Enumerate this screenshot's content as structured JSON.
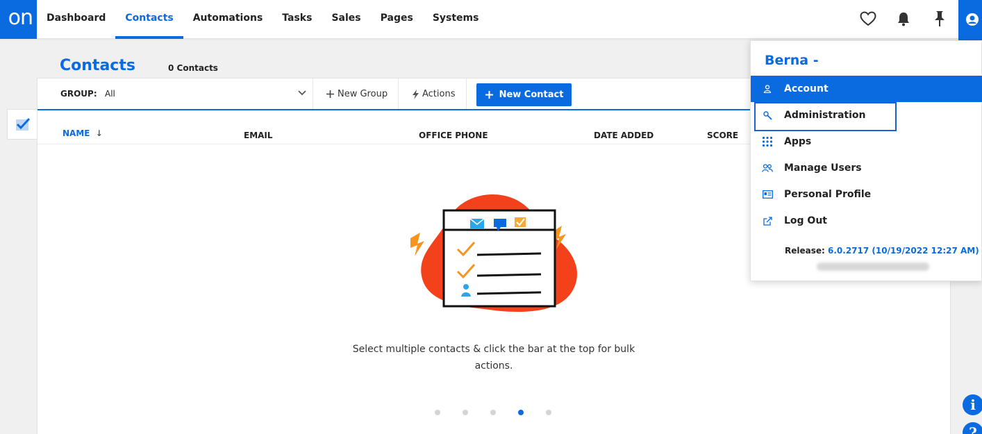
{
  "app": {
    "logo_text": "on"
  },
  "nav": {
    "items": [
      {
        "label": "Dashboard",
        "active": false
      },
      {
        "label": "Contacts",
        "active": true
      },
      {
        "label": "Automations",
        "active": false
      },
      {
        "label": "Tasks",
        "active": false
      },
      {
        "label": "Sales",
        "active": false
      },
      {
        "label": "Pages",
        "active": false
      },
      {
        "label": "Systems",
        "active": false
      }
    ],
    "icons": [
      "heart-icon",
      "bell-icon",
      "pin-icon",
      "user-icon"
    ]
  },
  "page": {
    "title": "Contacts",
    "count": "0 Contacts"
  },
  "toolbar": {
    "group_label": "GROUP:",
    "group_value": "All",
    "new_group": "New Group",
    "actions": "Actions",
    "new_contact": "New Contact"
  },
  "table": {
    "columns": [
      "NAME",
      "EMAIL",
      "OFFICE PHONE",
      "DATE ADDED",
      "SCORE"
    ],
    "sort_indicator": "↓"
  },
  "empty_state": {
    "message": "Select multiple contacts & click the bar at the top for bulk actions.",
    "dots": 5,
    "active_dot": 3
  },
  "user_menu": {
    "name": "Berna -",
    "items": [
      {
        "label": "Account",
        "icon": "person-icon",
        "active": true
      },
      {
        "label": "Administration",
        "icon": "wrench-icon",
        "active": false
      },
      {
        "label": "Apps",
        "icon": "grid-icon",
        "active": false
      },
      {
        "label": "Manage Users",
        "icon": "users-icon",
        "active": false
      },
      {
        "label": "Personal Profile",
        "icon": "id-card-icon",
        "active": false
      },
      {
        "label": "Log Out",
        "icon": "external-link-icon",
        "active": false
      }
    ],
    "release_label": "Release:",
    "release_version": "6.0.2717 (10/19/2022 12:27 AM)"
  },
  "colors": {
    "accent": "#0a6be0",
    "illustration_blob": "#f2411b",
    "illustration_accent": "#f7941d"
  }
}
